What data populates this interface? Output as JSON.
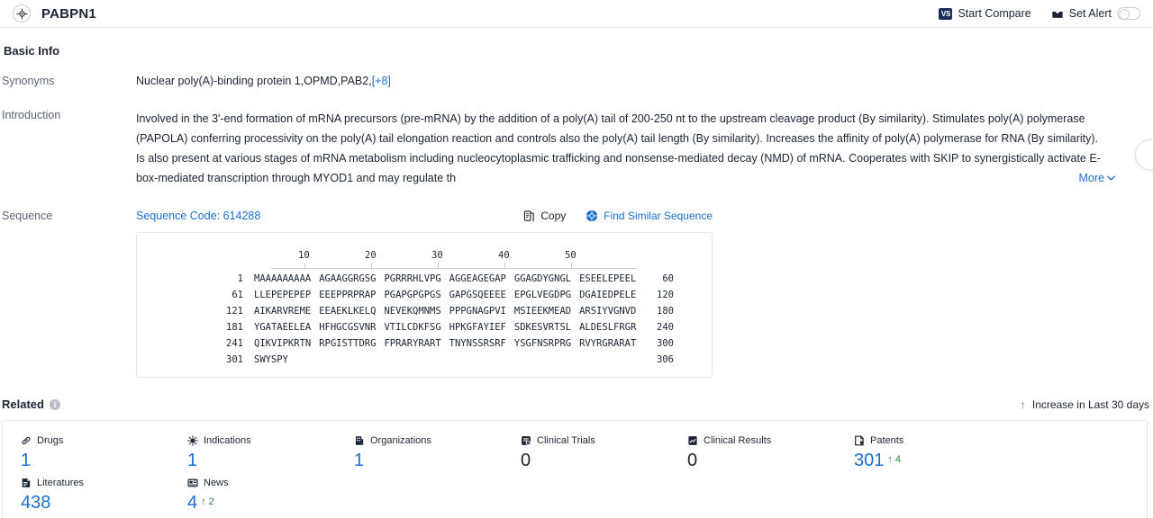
{
  "header": {
    "title": "PABPN1",
    "logo_icon": "target-icon",
    "compare_label": "Start Compare",
    "compare_badge": "VS",
    "alert_label": "Set Alert",
    "alert_icon": "alert-bell-icon",
    "toggle_state": "off"
  },
  "basic_info": {
    "section_label": "Basic Info",
    "synonyms_label": "Synonyms",
    "synonyms_value": "Nuclear poly(A)-binding protein 1,OPMD,PAB2,",
    "synonyms_more": "[+8]",
    "introduction_label": "Introduction",
    "introduction_text": "Involved in the 3'-end formation of mRNA precursors (pre-mRNA) by the addition of a poly(A) tail of 200-250 nt to the upstream cleavage product (By similarity). Stimulates poly(A) polymerase (PAPOLA) conferring processivity on the poly(A) tail elongation reaction and controls also the poly(A) tail length (By similarity). Increases the affinity of poly(A) polymerase for RNA (By similarity). Is also present at various stages of mRNA metabolism including nucleocytoplasmic trafficking and nonsense-mediated decay (NMD) of mRNA. Cooperates with SKIP to synergistically activate E-box-mediated transcription through MYOD1 and may regulate th",
    "more_label": "More",
    "more_icon": "chevron-down-icon"
  },
  "sequence": {
    "row_label": "Sequence",
    "code_label": "Sequence Code: 614288",
    "copy_label": "Copy",
    "copy_icon": "copy-icon",
    "find_similar_label": "Find Similar Sequence",
    "find_similar_icon": "target-icon",
    "ruler_ticks": [
      "10",
      "20",
      "30",
      "40",
      "50"
    ],
    "lines": [
      {
        "start": "1",
        "blocks": [
          "MAAAAAAAAA",
          "AGAAGGRGSG",
          "PGRRRHLVPG",
          "AGGEAGEGAP",
          "GGAGDYGNGL",
          "ESEELEPEEL"
        ],
        "end": "60"
      },
      {
        "start": "61",
        "blocks": [
          "LLEPEPEPEP",
          "EEEPPRPRAP",
          "PGAPGPGPGS",
          "GAPGSQEEEE",
          "EPGLVEGDPG",
          "DGAIEDPELE"
        ],
        "end": "120"
      },
      {
        "start": "121",
        "blocks": [
          "AIKARVREME",
          "EEAEKLKELQ",
          "NEVEKQMNMS",
          "PPPGNAGPVI",
          "MSIEEKMEAD",
          "ARSIYVGNVD"
        ],
        "end": "180"
      },
      {
        "start": "181",
        "blocks": [
          "YGATAEELEA",
          "HFHGCGSVNR",
          "VTILCDKFSG",
          "HPKGFAYIEF",
          "SDKESVRTSL",
          "ALDESLFRGR"
        ],
        "end": "240"
      },
      {
        "start": "241",
        "blocks": [
          "QIKVIPKRTN",
          "RPGISTTDRG",
          "FPRARYRART",
          "TNYNSSRSRF",
          "YSGFNSRPRG",
          "RVYRGRARAT"
        ],
        "end": "300"
      },
      {
        "start": "301",
        "blocks": [
          "SWYSPY"
        ],
        "end": "306"
      }
    ]
  },
  "related": {
    "title": "Related",
    "info_icon": "info-icon",
    "increase_label": "Increase in Last 30 days",
    "increase_icon": "arrow-up-icon",
    "stats": [
      {
        "label": "Drugs",
        "icon": "capsule-icon",
        "value": "1",
        "value_color": "blue",
        "delta": null
      },
      {
        "label": "Indications",
        "icon": "virus-icon",
        "value": "1",
        "value_color": "blue",
        "delta": null
      },
      {
        "label": "Organizations",
        "icon": "building-icon",
        "value": "1",
        "value_color": "blue",
        "delta": null
      },
      {
        "label": "Clinical Trials",
        "icon": "clinical-trial-icon",
        "value": "0",
        "value_color": "dark",
        "delta": null
      },
      {
        "label": "Clinical Results",
        "icon": "clinical-result-icon",
        "value": "0",
        "value_color": "dark",
        "delta": null
      },
      {
        "label": "Patents",
        "icon": "patent-icon",
        "value": "301",
        "value_color": "blue",
        "delta": "4"
      },
      {
        "label": "Literatures",
        "icon": "literature-icon",
        "value": "438",
        "value_color": "blue",
        "delta": null
      },
      {
        "label": "News",
        "icon": "news-icon",
        "value": "4",
        "value_color": "blue",
        "delta": "2"
      }
    ]
  },
  "colors": {
    "link_blue": "#1a6fd4",
    "value_blue": "#1a6fd4",
    "green": "#1f8a3b",
    "dark": "#1b2535"
  }
}
